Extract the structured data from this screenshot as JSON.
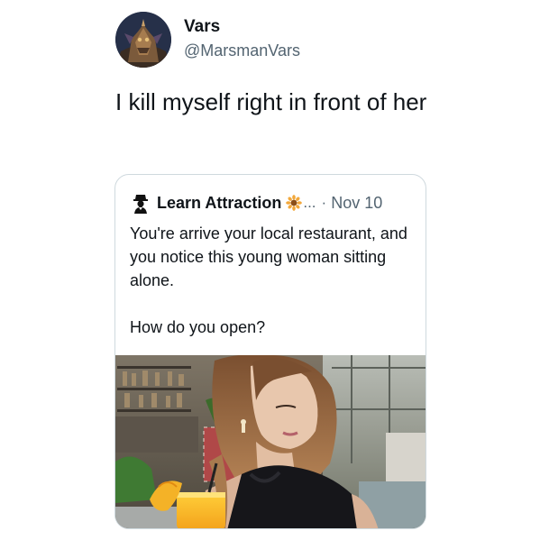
{
  "author": {
    "name": "Vars",
    "handle": "@MarsmanVars",
    "avatar_icon": "armored-figure-avatar"
  },
  "tweet": {
    "text": "I kill myself right in front of her"
  },
  "quoted_tweet": {
    "author_name": "Learn Attraction",
    "author_icon": "gentleman-avatar-icon",
    "badge_icon": "sunflower-badge-icon",
    "truncation": "...",
    "separator": "·",
    "date": "Nov 10",
    "paragraphs": [
      "You're arrive your local restaurant, and you notice this young woman sitting alone.",
      "How do you open?"
    ],
    "photo": "woman-sitting-in-restaurant-photo"
  },
  "colors": {
    "text_primary": "#0f1419",
    "text_secondary": "#536471",
    "card_border": "#cfd9de",
    "background": "#ffffff"
  }
}
